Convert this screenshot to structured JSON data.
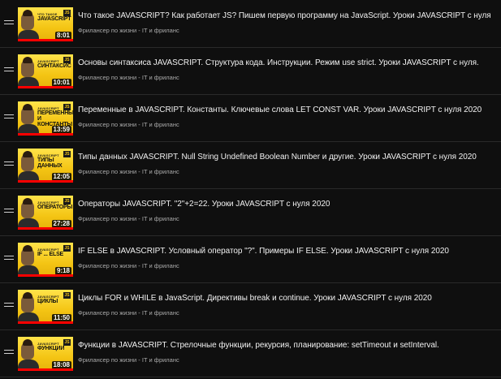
{
  "playlist": {
    "items": [
      {
        "topic_small": "ЧТО ТАКОЕ",
        "topic": "JAVASCRIPT",
        "duration": "8:01",
        "title": "Что такое JAVASCRIPT? Как работает JS? Пишем первую программу на JavaScript. Уроки JAVASCRIPT с нуля",
        "channel": "Фрилансер по жизни - IT и фриланс",
        "progress": 1.0
      },
      {
        "topic_small": "JAVASCRIPT",
        "topic": "СИНТАКСИС",
        "duration": "10:01",
        "title": "Основы синтаксиса JAVASCRIPT. Структура кода. Инструкции. Режим use strict. Уроки JAVASCRIPT с нуля.",
        "channel": "Фрилансер по жизни - IT и фриланс",
        "progress": 1.0
      },
      {
        "topic_small": "JAVASCRIPT",
        "topic": "ПЕРЕМЕННЫЕ\nИ КОНСТАНТЫ",
        "duration": "13:59",
        "title": "Переменные в JAVASCRIPT. Константы. Ключевые слова LET CONST VAR. Уроки JAVASCRIPT с нуля 2020",
        "channel": "Фрилансер по жизни - IT и фриланс",
        "progress": 1.0
      },
      {
        "topic_small": "JAVASCRIPT",
        "topic": "ТИПЫ ДАННЫХ",
        "duration": "12:05",
        "title": "Типы данных JAVASCRIPT. Null String Undefined Boolean Number и другие. Уроки JAVASCRIPT с нуля 2020",
        "channel": "Фрилансер по жизни - IT и фриланс",
        "progress": 1.0
      },
      {
        "topic_small": "JAVASCRIPT",
        "topic": "ОПЕРАТОРЫ",
        "duration": "27:28",
        "title": "Операторы JAVASCRIPT. \"2\"+2=22. Уроки JAVASCRIPT с нуля 2020",
        "channel": "Фрилансер по жизни - IT и фриланс",
        "progress": 1.0
      },
      {
        "topic_small": "JAVASCRIPT",
        "topic": "IF ... ELSE",
        "duration": "9:18",
        "title": "IF ELSE в JAVASCRIPT. Условный оператор \"?\". Примеры IF ELSE. Уроки JAVASCRIPT с нуля 2020",
        "channel": "Фрилансер по жизни - IT и фриланс",
        "progress": 1.0
      },
      {
        "topic_small": "JAVASCRIPT",
        "topic": "ЦИКЛЫ",
        "duration": "11:50",
        "title": "Циклы FOR и WHILE в JavaScript. Директивы break и continue. Уроки JAVASCRIPT с нуля 2020",
        "channel": "Фрилансер по жизни - IT и фриланс",
        "progress": 1.0
      },
      {
        "topic_small": "JAVASCRIPT",
        "topic": "ФУНКЦИИ",
        "duration": "18:08",
        "title": "Функции в JAVASCRIPT. Стрелочные функции, рекурсия, планирование: setTimeout и setInterval.",
        "channel": "Фрилансер по жизни - IT и фриланс",
        "progress": 1.0
      }
    ]
  },
  "icons": {
    "drag_handle": "drag-handle-icon",
    "js_badge": "JS"
  },
  "colors": {
    "background": "#0f0f0f",
    "thumbnail_yellow": "#f4c514",
    "progress_red": "#ff0000",
    "title_text": "#f1f1f1",
    "channel_text": "#aaaaaa"
  }
}
